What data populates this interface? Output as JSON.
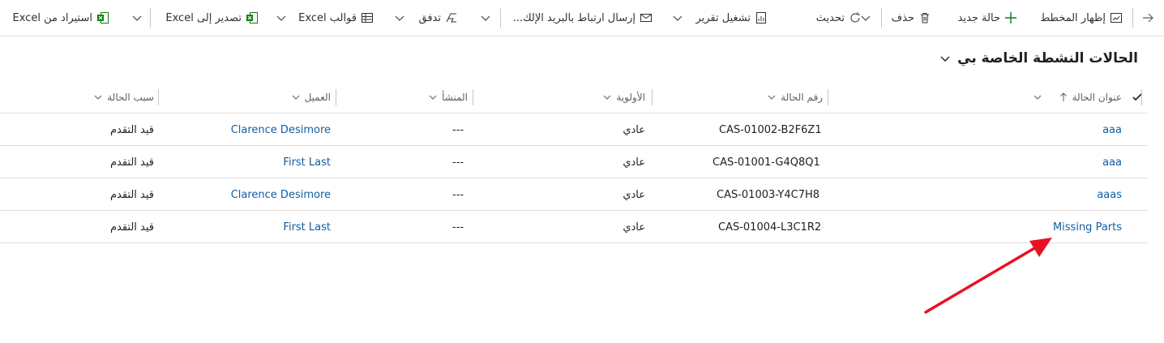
{
  "toolbar": {
    "show_chart": "إظهار المخطط",
    "new_case": "حالة جديد",
    "delete": "حذف",
    "refresh": "تحديث",
    "run_report": "تشغيل تقرير",
    "email_link": "إرسال ارتباط بالبريد الإلك...",
    "flow": "تدفق",
    "excel_templates": "قوالب Excel",
    "export_excel": "تصدير إلى Excel",
    "import_excel": "استيراد من Excel"
  },
  "view": {
    "title": "الحالات النشطة الخاصة بي"
  },
  "columns": {
    "case_title": "عنوان الحالة",
    "case_number": "رقم الحالة",
    "priority": "الأولوية",
    "origin": "المنشأ",
    "customer": "العميل",
    "status_reason": "سبب الحالة"
  },
  "rows": [
    {
      "title": "aaa",
      "number": "CAS-01002-B2F6Z1",
      "priority": "عادي",
      "origin": "---",
      "customer": "Clarence Desimore",
      "status": "قيد التقدم"
    },
    {
      "title": "aaa",
      "number": "CAS-01001-G4Q8Q1",
      "priority": "عادي",
      "origin": "---",
      "customer": "First Last",
      "status": "قيد التقدم"
    },
    {
      "title": "aaas",
      "number": "CAS-01003-Y4C7H8",
      "priority": "عادي",
      "origin": "---",
      "customer": "Clarence Desimore",
      "status": "قيد التقدم"
    },
    {
      "title": "Missing Parts",
      "number": "CAS-01004-L3C1R2",
      "priority": "عادي",
      "origin": "---",
      "customer": "First Last",
      "status": "قيد التقدم"
    }
  ],
  "colors": {
    "link": "#115ea3",
    "accent_green": "#107c10",
    "arrow": "#e81123"
  }
}
